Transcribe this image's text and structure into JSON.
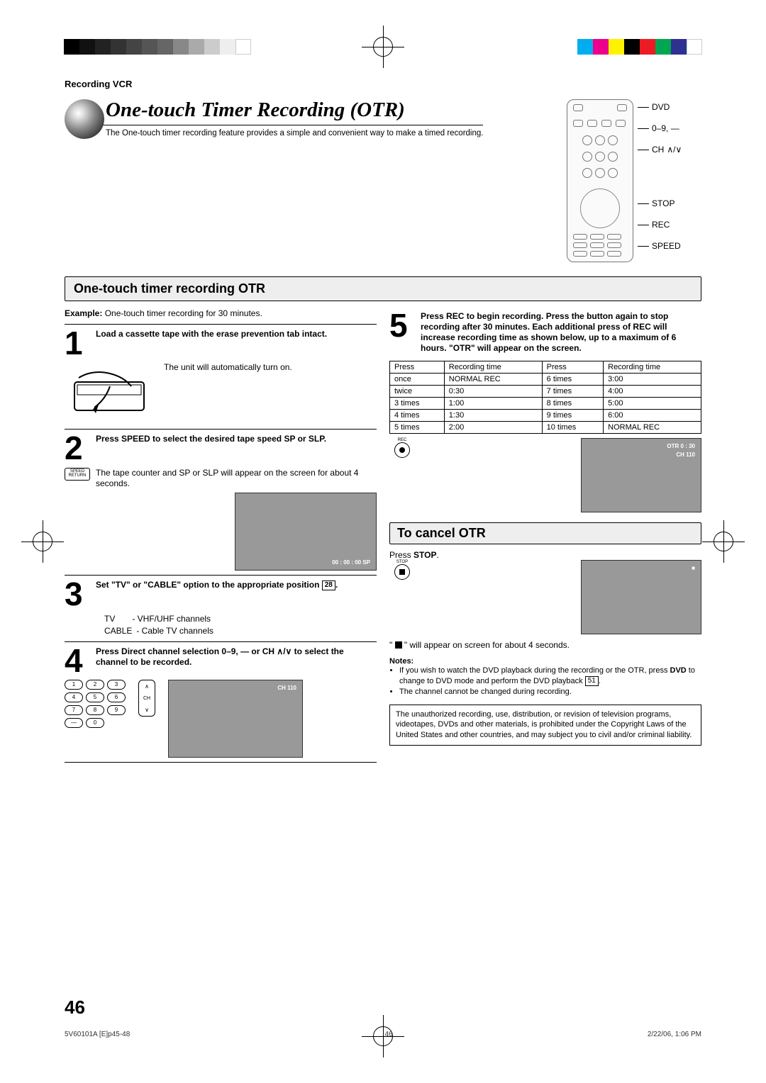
{
  "header": {
    "section": "Recording VCR"
  },
  "title": {
    "heading": "One-touch Timer Recording (OTR)",
    "intro": "The One-touch timer recording feature provides a simple and convenient way to make a timed recording."
  },
  "remote_labels": {
    "dvd": "DVD",
    "digits": "0–9, —",
    "ch": "CH",
    "stop": "STOP",
    "rec": "REC",
    "speed": "SPEED"
  },
  "section_heading": "One-touch timer recording OTR",
  "example": {
    "label": "Example:",
    "text": " One-touch timer recording for 30 minutes."
  },
  "steps": {
    "s1": {
      "num": "1",
      "title": "Load a cassette tape with the erase prevention tab intact.",
      "text": "The unit will automatically turn on."
    },
    "s2": {
      "num": "2",
      "title": "Press SPEED to select the desired tape speed SP or SLP.",
      "text": "The tape counter and SP or SLP will appear on the screen for about 4 seconds.",
      "key_label": "SPEED RETURN",
      "screen_text": "00 : 00 : 00  SP"
    },
    "s3": {
      "num": "3",
      "title_a": "Set \"TV\" or \"CABLE\" option to the appropriate position ",
      "pageref": "28",
      "title_b": ".",
      "tv_line": "TV  - VHF/UHF channels",
      "cable_line": "CABLE - Cable TV channels"
    },
    "s4": {
      "num": "4",
      "title": "Press Direct channel selection 0–9, — or CH ∧/∨ to select the channel to be recorded.",
      "screen_text": "CH 110",
      "ch_label": "CH",
      "keys": [
        "1",
        "2",
        "3",
        "4",
        "5",
        "6",
        "7",
        "8",
        "9",
        "—",
        "0"
      ]
    },
    "s5": {
      "num": "5",
      "title": "Press REC to begin recording. Press the button again to stop recording after 30 minutes. Each additional press of REC will increase recording time as shown below, up to a maximum of 6 hours. \"OTR\" will appear on the screen.",
      "table": {
        "headers": [
          "Press",
          "Recording time",
          "Press",
          "Recording time"
        ],
        "rows": [
          [
            "once",
            "NORMAL REC",
            "6 times",
            "3:00"
          ],
          [
            "twice",
            "0:30",
            "7 times",
            "4:00"
          ],
          [
            "3 times",
            "1:00",
            "8 times",
            "5:00"
          ],
          [
            "4 times",
            "1:30",
            "9 times",
            "6:00"
          ],
          [
            "5 times",
            "2:00",
            "10 times",
            "NORMAL REC"
          ]
        ]
      },
      "rec_label": "REC",
      "screen_text1": "OTR 0 : 30",
      "screen_text2": "CH 110"
    }
  },
  "cancel": {
    "heading": "To cancel OTR",
    "press_a": "Press ",
    "press_b": "STOP",
    "press_c": ".",
    "stop_label": "STOP",
    "appear": "\"   \" will appear on screen for about 4 seconds."
  },
  "notes": {
    "label": "Notes:",
    "n1a": "If you wish to watch the DVD playback during the recording or the OTR, press ",
    "n1b": "DVD",
    "n1c": " to change to DVD mode and perform the DVD playback ",
    "n1_ref": "51",
    "n1d": ".",
    "n2": "The channel cannot be changed during recording."
  },
  "disclaimer": "The unauthorized recording, use, distribution, or revision of television programs, videotapes, DVDs and other materials, is prohibited under the Copyright Laws of the United States and other countries, and may subject you to civil and/or criminal liability.",
  "page_number": "46",
  "footer": {
    "left": "5V60101A [E]p45-48",
    "mid": "46",
    "right": "2/22/06, 1:06 PM"
  }
}
